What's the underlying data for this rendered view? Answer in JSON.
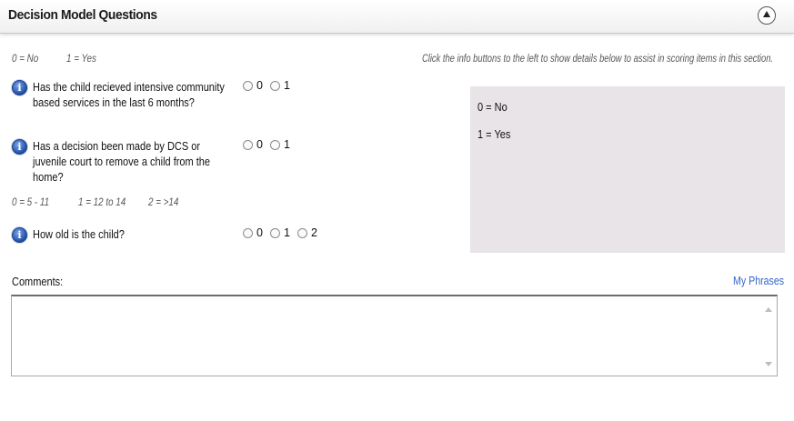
{
  "section": {
    "title": "Decision Model Questions",
    "collapse_icon": "chevron-up-icon"
  },
  "legend_1": {
    "no": "0 = No",
    "yes": "1 = Yes"
  },
  "hint_text": "Click the info buttons to the left to show details below to assist in scoring items in this section.",
  "questions": [
    {
      "info_icon": "info-icon",
      "text": "Has the child recieved intensive community based services in the last 6 months?",
      "options": [
        "0",
        "1"
      ]
    },
    {
      "info_icon": "info-icon",
      "text": "Has a decision been made by DCS or juvenile court to remove a child from the home?",
      "options": [
        "0",
        "1"
      ]
    },
    {
      "info_icon": "info-icon",
      "text": "How old is the child?",
      "options": [
        "0",
        "1",
        "2"
      ]
    }
  ],
  "legend_2": {
    "a": "0 = 5 - 11",
    "b": "1 = 12 to 14",
    "c": "2 = >14"
  },
  "info_panel": {
    "line1": "0 = No",
    "line2": "1  = Yes"
  },
  "comments": {
    "label": "Comments:",
    "my_phrases": "My Phrases",
    "value": ""
  },
  "colors": {
    "link": "#3366cc",
    "panel_bg": "#e8e4e7",
    "info_icon": "#1f4fa8"
  }
}
